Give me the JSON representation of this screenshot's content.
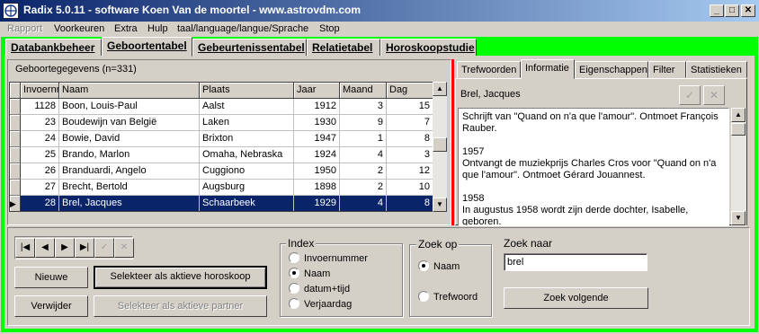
{
  "window": {
    "title": "Radix 5.0.11 - software Koen Van de moortel - www.astrovdm.com",
    "minimize": "_",
    "maximize": "□",
    "close": "✕"
  },
  "menu": [
    {
      "label": "Rapport",
      "disabled": true
    },
    {
      "label": "Voorkeuren"
    },
    {
      "label": "Extra"
    },
    {
      "label": "Hulp"
    },
    {
      "label": "taal/language/langue/Sprache"
    },
    {
      "label": "Stop"
    }
  ],
  "main_tabs": [
    "Databankbeheer",
    "Geboortentabel",
    "Gebeurtenissentabel",
    "Relatietabel",
    "Horoskoopstudie"
  ],
  "active_main_tab": "Geboortentabel",
  "grid": {
    "caption": "Geboortegegevens (n=331)",
    "columns": [
      "Invoernr",
      "Naam",
      "Plaats",
      "Jaar",
      "Maand",
      "Dag"
    ],
    "rows": [
      [
        "1128",
        "Boon, Louis-Paul",
        "Aalst",
        "1912",
        "3",
        "15"
      ],
      [
        "23",
        "Boudewijn van België",
        "Laken",
        "1930",
        "9",
        "7"
      ],
      [
        "24",
        "Bowie, David",
        "Brixton",
        "1947",
        "1",
        "8"
      ],
      [
        "25",
        "Brando, Marlon",
        "Omaha, Nebraska",
        "1924",
        "4",
        "3"
      ],
      [
        "26",
        "Branduardi, Angelo",
        "Cuggiono",
        "1950",
        "2",
        "12"
      ],
      [
        "27",
        "Brecht, Bertold",
        "Augsburg",
        "1898",
        "2",
        "10"
      ],
      [
        "28",
        "Brel, Jacques",
        "Schaarbeek",
        "1929",
        "4",
        "8"
      ]
    ],
    "selected_row": 6
  },
  "right_tabs": [
    "Trefwoorden",
    "Informatie",
    "Eigenschappen",
    "Filter",
    "Statistieken"
  ],
  "active_right_tab": "Informatie",
  "info": {
    "name": "Brel, Jacques",
    "memo": [
      "Schrijft van \"Quand on n'a que l'amour\". Ontmoet François Rauber.",
      "1957\nOntvangt de muziekprijs Charles Cros voor \"Quand on n'a que l'amour\". Ontmoet Gérard Jouannest.",
      "1958\nIn augustus 1958 wordt zijn derde dochter, Isabelle, geboren."
    ]
  },
  "buttons": {
    "new": "Nieuwe",
    "delete": "Verwijder",
    "select_active": "Selekteer als aktieve horoskoop",
    "select_partner": "Selekteer als aktieve partner",
    "find_next": "Zoek volgende"
  },
  "index_group": {
    "title": "Index",
    "options": [
      "Invoernummer",
      "Naam",
      "datum+tijd",
      "Verjaardag"
    ],
    "selected": 1
  },
  "search_on": {
    "title": "Zoek op",
    "options": [
      "Naam",
      "Trefwoord"
    ],
    "selected": 0
  },
  "search": {
    "label": "Zoek naar",
    "value": "brel"
  },
  "colors": {
    "frame": "#00ff00",
    "splitter": "#ff0000",
    "selection": "#0a246a"
  }
}
